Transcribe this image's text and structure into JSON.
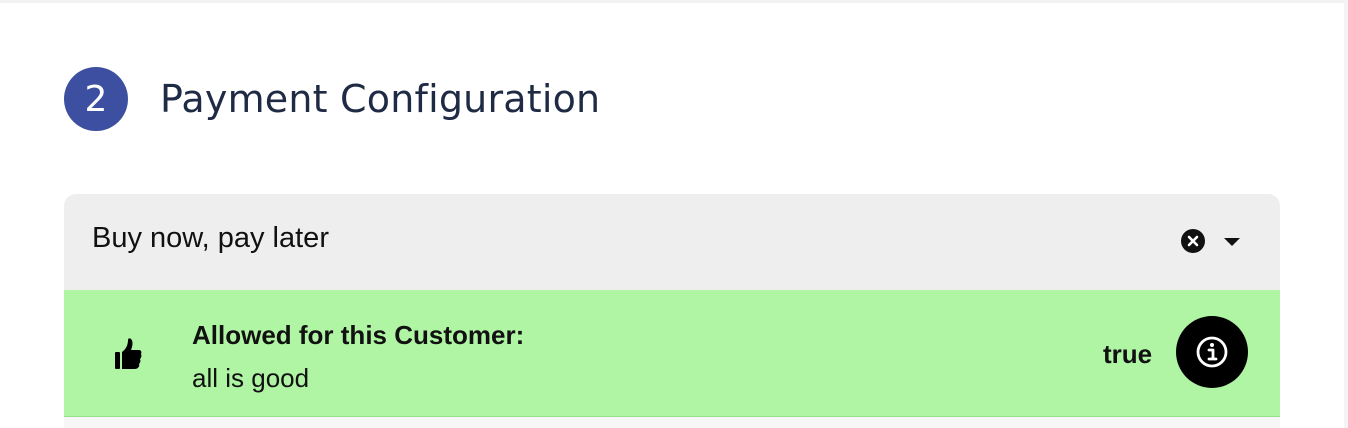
{
  "step": {
    "number": "2",
    "title": "Payment Configuration"
  },
  "select": {
    "value": "Buy now, pay later",
    "clear_icon": "close-circle-icon",
    "toggle_icon": "caret-down-icon"
  },
  "status": {
    "icon": "thumbs-up-icon",
    "title": "Allowed for this Customer:",
    "message": "all is good",
    "value": "true",
    "info_icon": "info-icon"
  },
  "colors": {
    "step_badge": "#3d4fa0",
    "select_background": "#eeeeee",
    "status_background": "#b0f5a4",
    "info_button": "#000000"
  }
}
